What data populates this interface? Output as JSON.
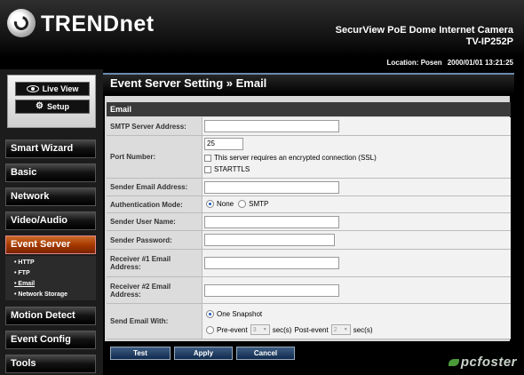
{
  "header": {
    "brand": "TRENDnet",
    "product_title": "SecurView PoE Dome Internet Camera",
    "product_model": "TV-IP252P",
    "location_label": "Location: Posen",
    "datetime": "2000/01/01 13:21:25"
  },
  "sidebar": {
    "live_view": "Live View",
    "setup": "Setup",
    "items": [
      {
        "label": "Smart Wizard"
      },
      {
        "label": "Basic"
      },
      {
        "label": "Network"
      },
      {
        "label": "Video/Audio"
      },
      {
        "label": "Event Server"
      },
      {
        "label": "Motion Detect"
      },
      {
        "label": "Event Config"
      },
      {
        "label": "Tools"
      }
    ],
    "subitems": [
      {
        "label": "HTTP"
      },
      {
        "label": "FTP"
      },
      {
        "label": "Email"
      },
      {
        "label": "Network Storage"
      }
    ]
  },
  "main": {
    "title": "Event Server Setting » Email",
    "section": "Email",
    "fields": {
      "smtp_label": "SMTP Server Address:",
      "smtp_value": "",
      "port_label": "Port Number:",
      "port_value": "25",
      "ssl_label": "This server requires an encrypted connection (SSL)",
      "starttls_label": "STARTTLS",
      "sender_email_label": "Sender Email Address:",
      "sender_email_value": "",
      "auth_label": "Authentication Mode:",
      "auth_none": "None",
      "auth_smtp": "SMTP",
      "sender_user_label": "Sender User Name:",
      "sender_user_value": "",
      "sender_pass_label": "Sender Password:",
      "sender_pass_value": "",
      "recv1_label": "Receiver #1 Email Address:",
      "recv1_value": "",
      "recv2_label": "Receiver #2 Email Address:",
      "recv2_value": "",
      "send_with_label": "Send Email With:",
      "one_snapshot": "One Snapshot",
      "pre_event": "Pre-event",
      "pre_value": "3",
      "secs": "sec(s)",
      "post_event": "Post-event",
      "post_value": "2",
      "secs2": "sec(s)"
    },
    "buttons": {
      "test": "Test",
      "apply": "Apply",
      "cancel": "Cancel"
    }
  },
  "watermark": "pcfoster",
  "colors": {
    "active_nav": "#a63a00",
    "button": "#1f3d66",
    "panel_accent": "#6a8bb0"
  }
}
